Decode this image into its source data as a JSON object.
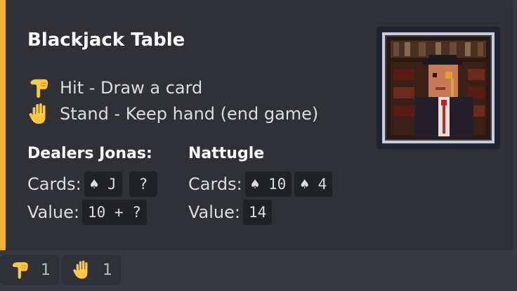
{
  "embed": {
    "title": "Blackjack Table",
    "accent_color": "#f0b232",
    "actions": [
      {
        "icon": "hand-pointing-down-icon",
        "label": "Hit - Draw a card"
      },
      {
        "icon": "raised-hand-icon",
        "label": "Stand - Keep hand (end game)"
      }
    ],
    "dealer": {
      "name": "Dealers Jonas:",
      "cards_label": "Cards:",
      "cards": [
        "♠ J",
        " ? "
      ],
      "value_label": "Value:",
      "value": "10 + ?"
    },
    "player": {
      "name": "Nattugle",
      "cards_label": "Cards:",
      "cards": [
        "♠ 10",
        "♠ 4"
      ],
      "value_label": "Value:",
      "value": "14"
    },
    "thumbnail_icon": "dealer-portrait-icon"
  },
  "reactions": [
    {
      "icon": "hand-pointing-down-icon",
      "count": "1"
    },
    {
      "icon": "raised-hand-icon",
      "count": "1"
    }
  ]
}
